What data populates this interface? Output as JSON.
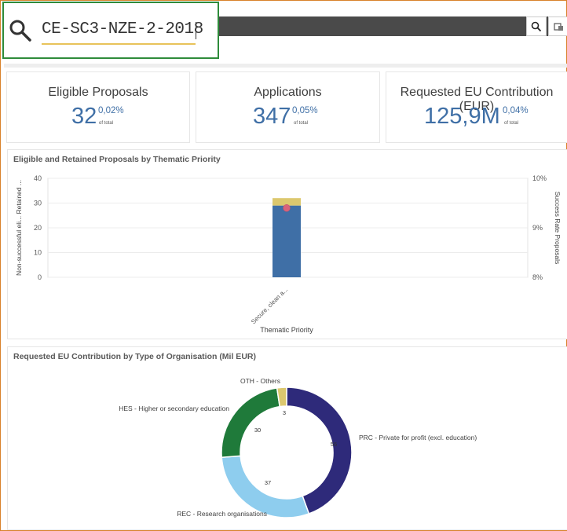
{
  "search": {
    "query": "CE-SC3-NZE-2-2018"
  },
  "kpis": [
    {
      "title": "Eligible Proposals",
      "value": "32",
      "pct": "0,02%",
      "sub": "of total"
    },
    {
      "title": "Applications",
      "value": "347",
      "pct": "0,05%",
      "sub": "of total"
    },
    {
      "title": "Requested EU Contribution (EUR)",
      "value": "125,9M",
      "pct": "0,04%",
      "sub": "of total"
    }
  ],
  "bar_panel": {
    "title": "Eligible and Retained Proposals by Thematic Priority",
    "left_axis_label": "Non-successful eli... Retained ...",
    "right_axis_label": "Success Rate Proposals",
    "x_axis_label": "Thematic Priority",
    "category_label": "Secure, clean a..."
  },
  "donut_panel": {
    "title": "Requested EU Contribution by Type of Organisation (Mil EUR)"
  },
  "chart_data": [
    {
      "type": "bar",
      "stacked": true,
      "categories": [
        "Secure, clean a..."
      ],
      "series": [
        {
          "name": "Retained",
          "values": [
            29
          ],
          "color": "#3f6fa6"
        },
        {
          "name": "Non-successful eligible",
          "values": [
            3
          ],
          "color": "#dcc86e"
        }
      ],
      "line_series": {
        "name": "Success Rate Proposals",
        "values": [
          9.4
        ],
        "unit": "%",
        "color": "#d9627a"
      },
      "ylim": [
        0,
        40
      ],
      "yticks": [
        0,
        10,
        20,
        30,
        40
      ],
      "y2lim": [
        8,
        10
      ],
      "y2ticks": [
        "8%",
        "9%",
        "10%"
      ],
      "xlabel": "Thematic Priority",
      "ylabel": "Non-successful eli... Retained ...",
      "y2label": "Success Rate Proposals"
    },
    {
      "type": "pie",
      "donut": true,
      "slices": [
        {
          "label": "PRC - Private for profit (excl. education)",
          "value": 56,
          "color": "#2e2a7a"
        },
        {
          "label": "REC - Research organisations",
          "value": 37,
          "color": "#8ecdee"
        },
        {
          "label": "HES - Higher or secondary education",
          "value": 30,
          "color": "#1f7a3a"
        },
        {
          "label": "OTH - Others",
          "value": 3,
          "color": "#dcc86e"
        }
      ]
    }
  ]
}
